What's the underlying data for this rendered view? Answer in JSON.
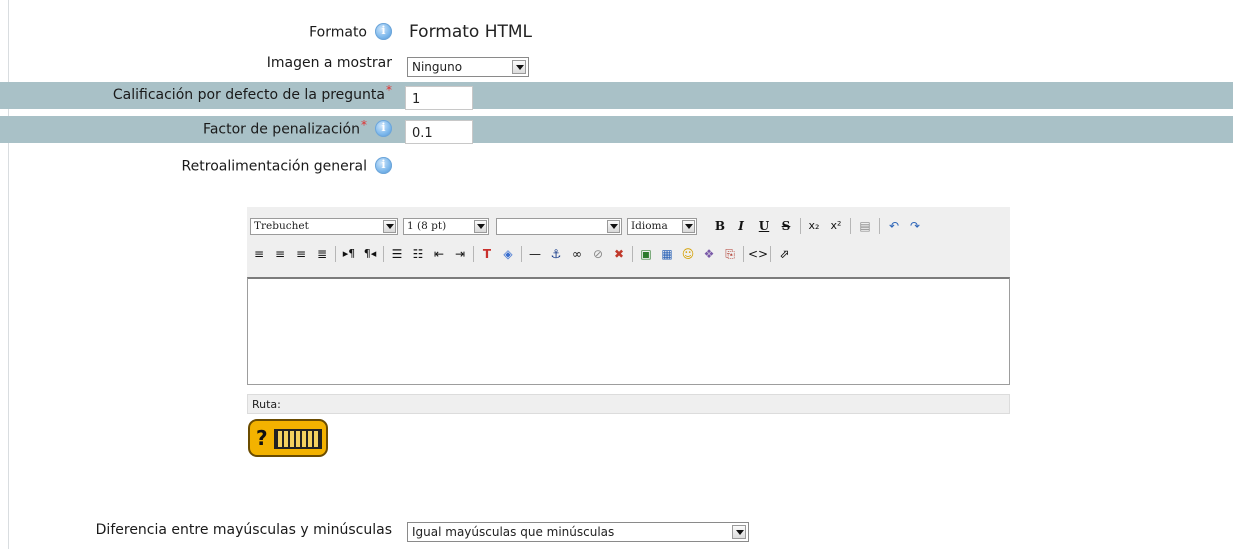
{
  "form": {
    "format": {
      "label": "Formato",
      "value": "Formato HTML"
    },
    "image": {
      "label": "Imagen a mostrar",
      "selected": "Ninguno"
    },
    "default_grade": {
      "label": "Calificación por defecto de la pregunta",
      "required_mark": "*",
      "value": "1"
    },
    "penalty": {
      "label": "Factor de penalización",
      "required_mark": "*",
      "value": "0.1"
    },
    "general_feedback": {
      "label": "Retroalimentación general"
    },
    "case_sensitivity": {
      "label": "Diferencia entre mayúsculas y minúsculas",
      "selected": "Igual mayúsculas que minúsculas"
    }
  },
  "editor": {
    "font_family": "Trebuchet",
    "font_size": "1 (8 pt)",
    "heading": "",
    "language": "Idioma",
    "status_path": "Ruta:",
    "bold": "B",
    "italic": "I",
    "underline": "U",
    "strike": "S"
  },
  "colors": {
    "band": "#a9c1c7",
    "required": "#e03030",
    "help_badge": "#f3b200"
  }
}
